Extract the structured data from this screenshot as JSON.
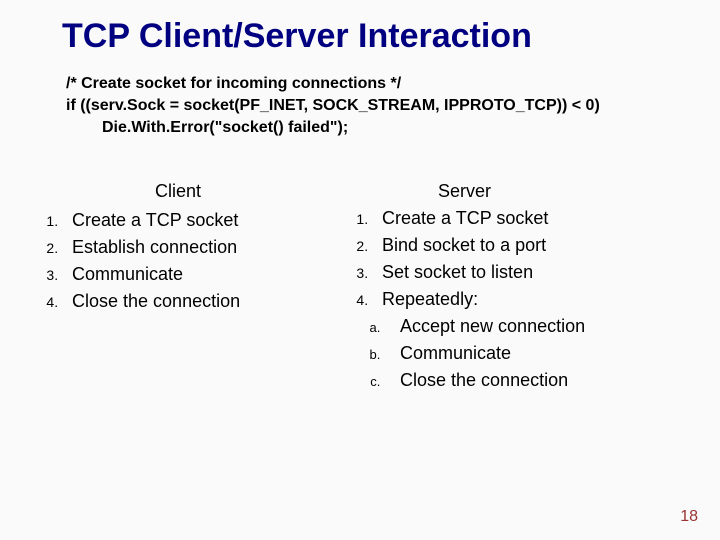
{
  "title": "TCP Client/Server Interaction",
  "code": {
    "l1": "/* Create socket for incoming connections */",
    "l2": "if ((serv.Sock = socket(PF_INET, SOCK_STREAM, IPPROTO_TCP)) < 0)",
    "l3": "Die.With.Error(\"socket() failed\");"
  },
  "client": {
    "heading": "Client",
    "items": [
      "Create a TCP socket",
      "Establish connection",
      "Communicate",
      "Close the connection"
    ]
  },
  "server": {
    "heading": "Server",
    "items": [
      "Create a TCP socket",
      "Bind socket to a port",
      "Set socket to listen",
      "Repeatedly:"
    ],
    "sub": [
      "Accept new connection",
      "Communicate",
      "Close the connection"
    ]
  },
  "page_number": "18"
}
